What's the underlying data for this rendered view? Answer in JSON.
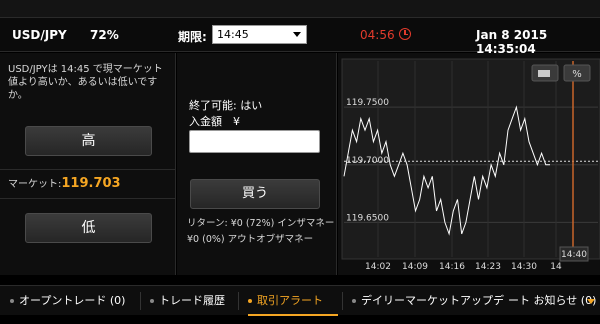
{
  "header": {
    "symbol": "USD/JPY",
    "payout_pct": "72%",
    "expiry_label": "期限:",
    "expiry_value": "14:45",
    "countdown": "04:56",
    "datetime": "Jan 8 2015   14:35:04"
  },
  "left_panel": {
    "description": "USD/JPYは 14:45 で現マーケット値より高いか、あるいは低いですか。",
    "high_label": "高",
    "market_label": "マーケット:",
    "market_value": "119.703",
    "low_label": "低"
  },
  "order_panel": {
    "finish_label": "終了可能: はい",
    "amount_label": "入金額　¥",
    "amount_value": "",
    "buy_label": "買う",
    "return_note": "リターン: ¥0 (72%) インザマネー",
    "otm_note": "¥0 (0%) アウトオブザマネー"
  },
  "chart_data": {
    "type": "line",
    "y_labels": [
      "119.7500",
      "119.7000",
      "119.6500"
    ],
    "x_labels": [
      "14:02",
      "14:09",
      "14:16",
      "14:23",
      "14:30",
      "14"
    ],
    "ylim": [
      119.62,
      119.79
    ],
    "grid": true,
    "current_value": 119.703,
    "expiry_marker_label": "14:40",
    "percent_button": "%",
    "series": [
      {
        "values": [
          119.69,
          119.71,
          119.73,
          119.72,
          119.74,
          119.73,
          119.74,
          119.72,
          119.73,
          119.71,
          119.72,
          119.7,
          119.69,
          119.7,
          119.71,
          119.7,
          119.68,
          119.66,
          119.67,
          119.69,
          119.68,
          119.69,
          119.66,
          119.67,
          119.65,
          119.64,
          119.66,
          119.67,
          119.64,
          119.65,
          119.67,
          119.69,
          119.67,
          119.69,
          119.68,
          119.7,
          119.69,
          119.71,
          119.7,
          119.73,
          119.74,
          119.75,
          119.73,
          119.74,
          119.72,
          119.71,
          119.7,
          119.71,
          119.7,
          119.7
        ]
      }
    ]
  },
  "tabs": [
    {
      "label": "オープントレード",
      "count": "(0)",
      "active": false
    },
    {
      "label": "トレード履歴",
      "count": "",
      "active": false
    },
    {
      "label": "取引アラート",
      "count": "",
      "active": true
    },
    {
      "label": "デイリーマーケットアップデ",
      "count": "",
      "active": false
    },
    {
      "label": "ート お知らせ",
      "count": "(0)",
      "active": false
    }
  ]
}
